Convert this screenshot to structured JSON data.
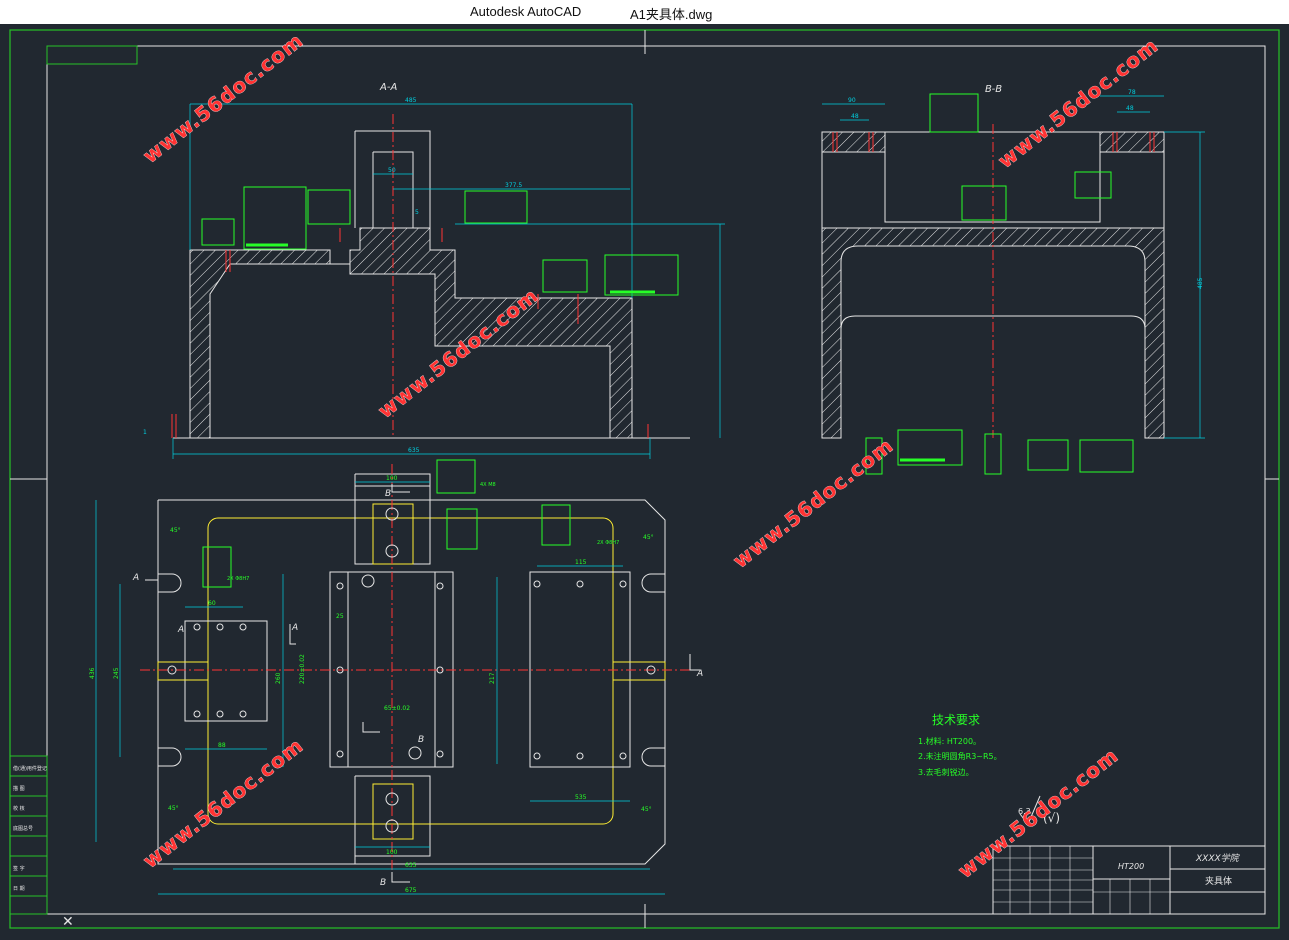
{
  "window": {
    "app_name": "Autodesk AutoCAD",
    "file_name": "A1夹具体.dwg"
  },
  "drawing": {
    "section_aa": "A-A",
    "section_bb": "B-B",
    "section_letter_a": "A",
    "section_letter_b": "B",
    "dims": {
      "d485": "485",
      "d90": "90",
      "d48": "48",
      "d78": "78",
      "d50": "50",
      "d3775": "377.5",
      "d5": "5",
      "d635": "635",
      "d675": "675",
      "d100": "100",
      "d60": "60",
      "d88": "88",
      "d115": "115",
      "d535": "535",
      "d245": "245",
      "d25": "25",
      "d217": "217",
      "d260": "260",
      "d65": "65±0.02",
      "d1": "1",
      "d436": "436",
      "d45deg": "45°",
      "d220": "220±0.02",
      "d2x": "2X Φ8H7",
      "d4x": "4X M8"
    },
    "tech_req": {
      "title": "技术要求",
      "lines": [
        "1.材料: HT200。",
        "2.未注明圆角R3~R5。",
        "3.去毛刺锐边。"
      ]
    },
    "roughness": "6.3",
    "title_block": {
      "material": "HT200",
      "school": "XXXX学院",
      "part_name": "夹具体",
      "left_labels": [
        "借(通)用件登记",
        "描 图",
        "校 核",
        "底图总号",
        "签 字",
        "日 期"
      ]
    },
    "watermark": "www.56doc.com"
  }
}
